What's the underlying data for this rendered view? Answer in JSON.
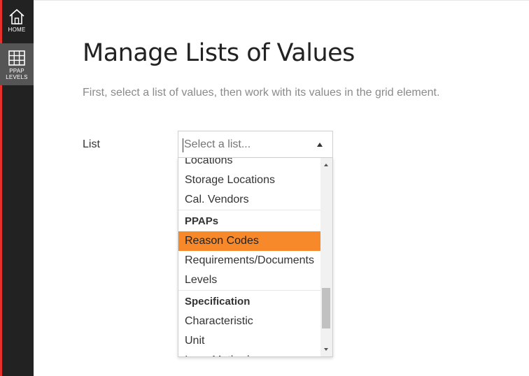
{
  "sidebar": {
    "accent_color": "#e8302a",
    "items": [
      {
        "label": "HOME",
        "icon": "home-icon"
      },
      {
        "label_line1": "PPAP",
        "label_line2": "LEVELS",
        "icon": "grid-icon",
        "active": true
      }
    ]
  },
  "page": {
    "title": "Manage Lists of Values",
    "subtitle": "First, select a list of values, then work with its values in the grid element."
  },
  "form": {
    "list_label": "List",
    "select_placeholder": "Select a list..."
  },
  "dropdown": {
    "highlight_color": "#f7892b",
    "items_top": [
      "Locations",
      "Storage Locations",
      "Cal. Vendors"
    ],
    "group_ppaps": "PPAPs",
    "items_ppaps": [
      "Reason Codes",
      "Requirements/Documents",
      "Levels"
    ],
    "group_spec": "Specification",
    "items_spec": [
      "Characteristic",
      "Unit",
      "Insp. Method"
    ]
  }
}
